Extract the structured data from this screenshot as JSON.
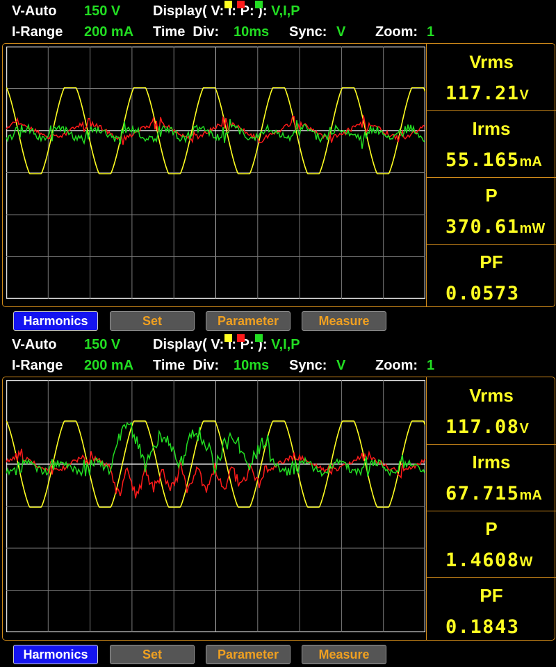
{
  "panels": [
    {
      "header": {
        "range_label": "V-Auto",
        "range_value": "150 V",
        "display_prefix": "Display( V:",
        "display_i": "I:",
        "display_p": "P:",
        "display_suffix": "):",
        "display_channels": "V,I,P",
        "irange_label": "I-Range",
        "irange_value": "200 mA",
        "timediv_label": "Time  Div:",
        "timediv_value": "10ms",
        "sync_label": "Sync:",
        "sync_value": "V",
        "zoom_label": "Zoom:",
        "zoom_value": "1"
      },
      "measurements": [
        {
          "label": "Vrms",
          "value": "117.21",
          "unit": "V"
        },
        {
          "label": "Irms",
          "value": "55.165",
          "unit": "mA"
        },
        {
          "label": "P",
          "value": "370.61",
          "unit": "mW"
        },
        {
          "label": "PF",
          "value": "0.0573",
          "unit": ""
        }
      ],
      "buttons": [
        "Harmonics",
        "Set",
        "Parameter",
        "Measure"
      ]
    },
    {
      "header": {
        "range_label": "V-Auto",
        "range_value": "150 V",
        "display_prefix": "Display( V:",
        "display_i": "I:",
        "display_p": "P:",
        "display_suffix": "):",
        "display_channels": "V,I,P",
        "irange_label": "I-Range",
        "irange_value": "200 mA",
        "timediv_label": "Time  Div:",
        "timediv_value": "10ms",
        "sync_label": "Sync:",
        "sync_value": "V",
        "zoom_label": "Zoom:",
        "zoom_value": "1"
      },
      "measurements": [
        {
          "label": "Vrms",
          "value": "117.08",
          "unit": "V"
        },
        {
          "label": "Irms",
          "value": "67.715",
          "unit": "mA"
        },
        {
          "label": "P",
          "value": "1.4608",
          "unit": "W"
        },
        {
          "label": "PF",
          "value": "0.1843",
          "unit": ""
        }
      ],
      "buttons": [
        "Harmonics",
        "Set",
        "Parameter",
        "Measure"
      ]
    }
  ],
  "colors": {
    "voltage": "#ffff22",
    "current": "#ff1a1a",
    "power": "#22dd22",
    "grid": "#7a7a7a",
    "accent": "#d08a1a"
  }
}
